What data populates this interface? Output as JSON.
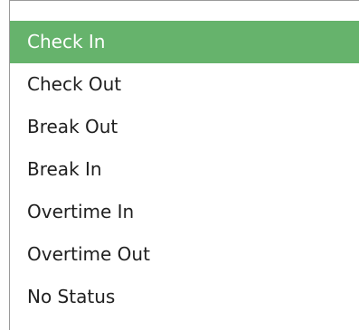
{
  "dropdown": {
    "selected_index": 0,
    "selected_color": "#66b36c",
    "items": [
      {
        "label": "Check In"
      },
      {
        "label": "Check Out"
      },
      {
        "label": "Break Out"
      },
      {
        "label": "Break In"
      },
      {
        "label": "Overtime In"
      },
      {
        "label": "Overtime Out"
      },
      {
        "label": "No Status"
      }
    ]
  }
}
